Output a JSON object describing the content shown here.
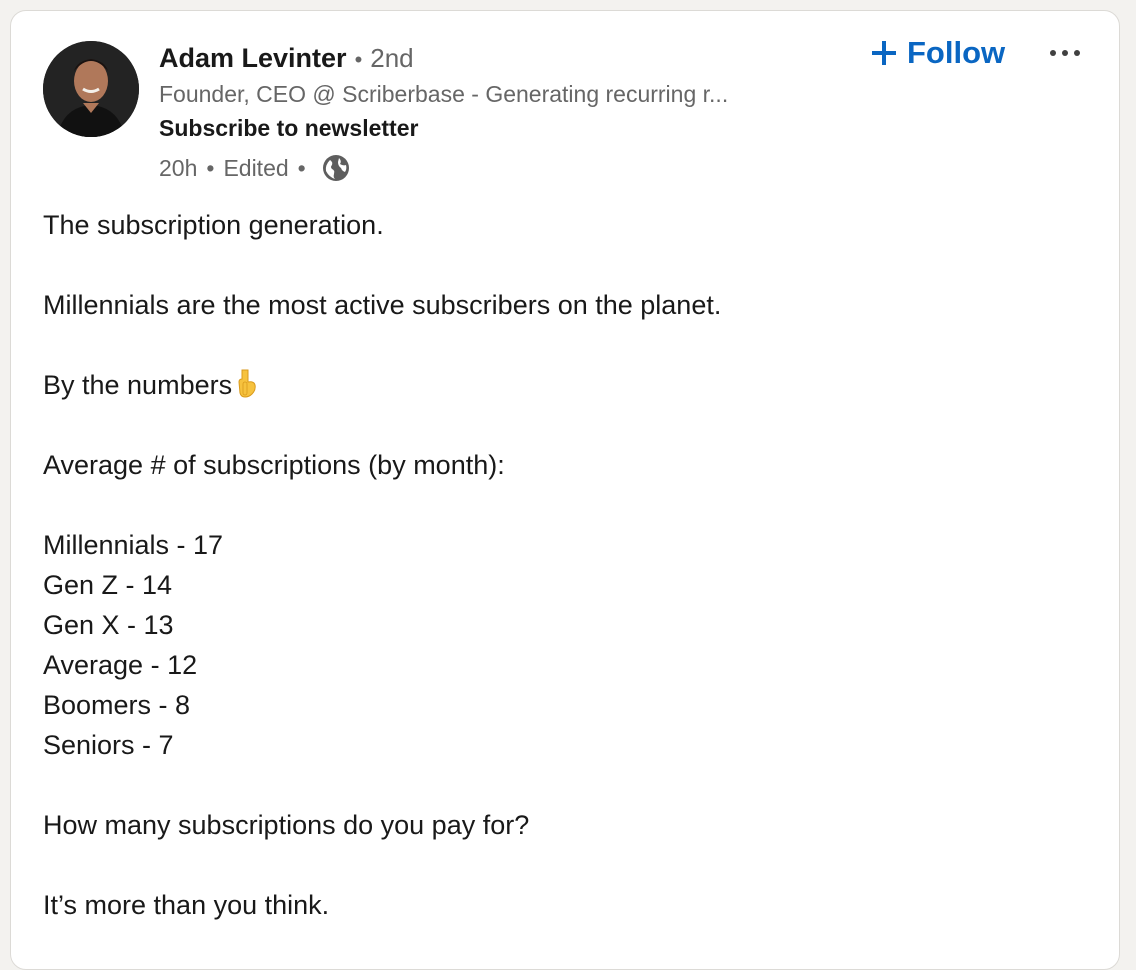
{
  "author": {
    "name": "Adam Levinter",
    "separator": "•",
    "degree": "2nd",
    "headline": "Founder, CEO @ Scriberbase - Generating recurring r...",
    "newsletter_label": "Subscribe to newsletter",
    "avatar_icon": "profile-photo"
  },
  "meta": {
    "time": "20h",
    "separator": "•",
    "edited": "Edited",
    "separator2": "•",
    "visibility_icon": "globe-icon"
  },
  "actions": {
    "follow_label": "Follow",
    "follow_icon": "plus-icon",
    "more_icon": "ellipsis-icon"
  },
  "post": {
    "line1": "The subscription generation.",
    "line2": "Millennials are the most active subscribers on the planet.",
    "line3": "By the numbers",
    "line3_emoji": "pointing-down-icon",
    "line4": "Average # of subscriptions (by month):",
    "stats": [
      "Millennials - 17",
      "Gen Z - 14",
      "Gen X - 13",
      "Average - 12",
      "Boomers - 8",
      "Seniors - 7"
    ],
    "question": "How many subscriptions do you pay for?",
    "closing": "It’s more than you think."
  },
  "colors": {
    "accent": "#0a66c2",
    "text_primary": "#191919",
    "text_secondary": "#666666",
    "card_bg": "#ffffff",
    "page_bg": "#f3f2ef"
  }
}
